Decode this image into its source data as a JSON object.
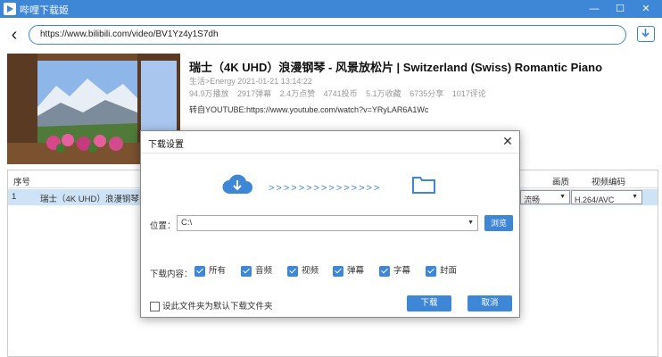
{
  "app": {
    "title": "哔哩下载姬"
  },
  "window_controls": {
    "minimize": "—",
    "maximize": "☐",
    "close": "✕"
  },
  "nav": {
    "back": "‹",
    "url": "https://www.bilibili.com/video/BV1Yz4y1S7dh"
  },
  "video": {
    "title": "瑞士（4K UHD）浪漫钢琴 - 风景放松片 | Switzerland (Swiss) Romantic Piano",
    "meta_line1": "生活>Energy    2021-01-21 13:14:22",
    "stats": [
      "94.9万播放",
      "2917弹幕",
      "2.4万点赞",
      "4741投币",
      "5.1万收藏",
      "6735分享",
      "1017评论"
    ],
    "source": "转自YOUTUBE:https://www.youtube.com/watch?v=YRyLAR6A1Wc"
  },
  "table": {
    "headers": {
      "index": "序号",
      "quality": "画质",
      "codec": "视频编码"
    },
    "rows": [
      {
        "index": "1",
        "name": "瑞士（4K UHD）浪漫钢琴 - 风",
        "quality": "流畅",
        "codec": "H.264/AVC"
      }
    ]
  },
  "dialog": {
    "title": "下载设置",
    "close": "✕",
    "arrows": ">>>>>>>>>>>>>>>",
    "location_label": "位置：",
    "location_value": "C:\\",
    "browse_label": "浏览",
    "content_label": "下载内容：",
    "options": [
      {
        "label": "所有",
        "checked": true
      },
      {
        "label": "音频",
        "checked": true
      },
      {
        "label": "视频",
        "checked": true
      },
      {
        "label": "弹幕",
        "checked": true
      },
      {
        "label": "字幕",
        "checked": true
      },
      {
        "label": "封面",
        "checked": true
      }
    ],
    "default_folder_label": "设此文件夹为默认下载文件夹",
    "download_button": "下载",
    "cancel_button": "取消"
  },
  "colors": {
    "accent": "#3e86d6",
    "row_selected": "#cfe3f6"
  }
}
